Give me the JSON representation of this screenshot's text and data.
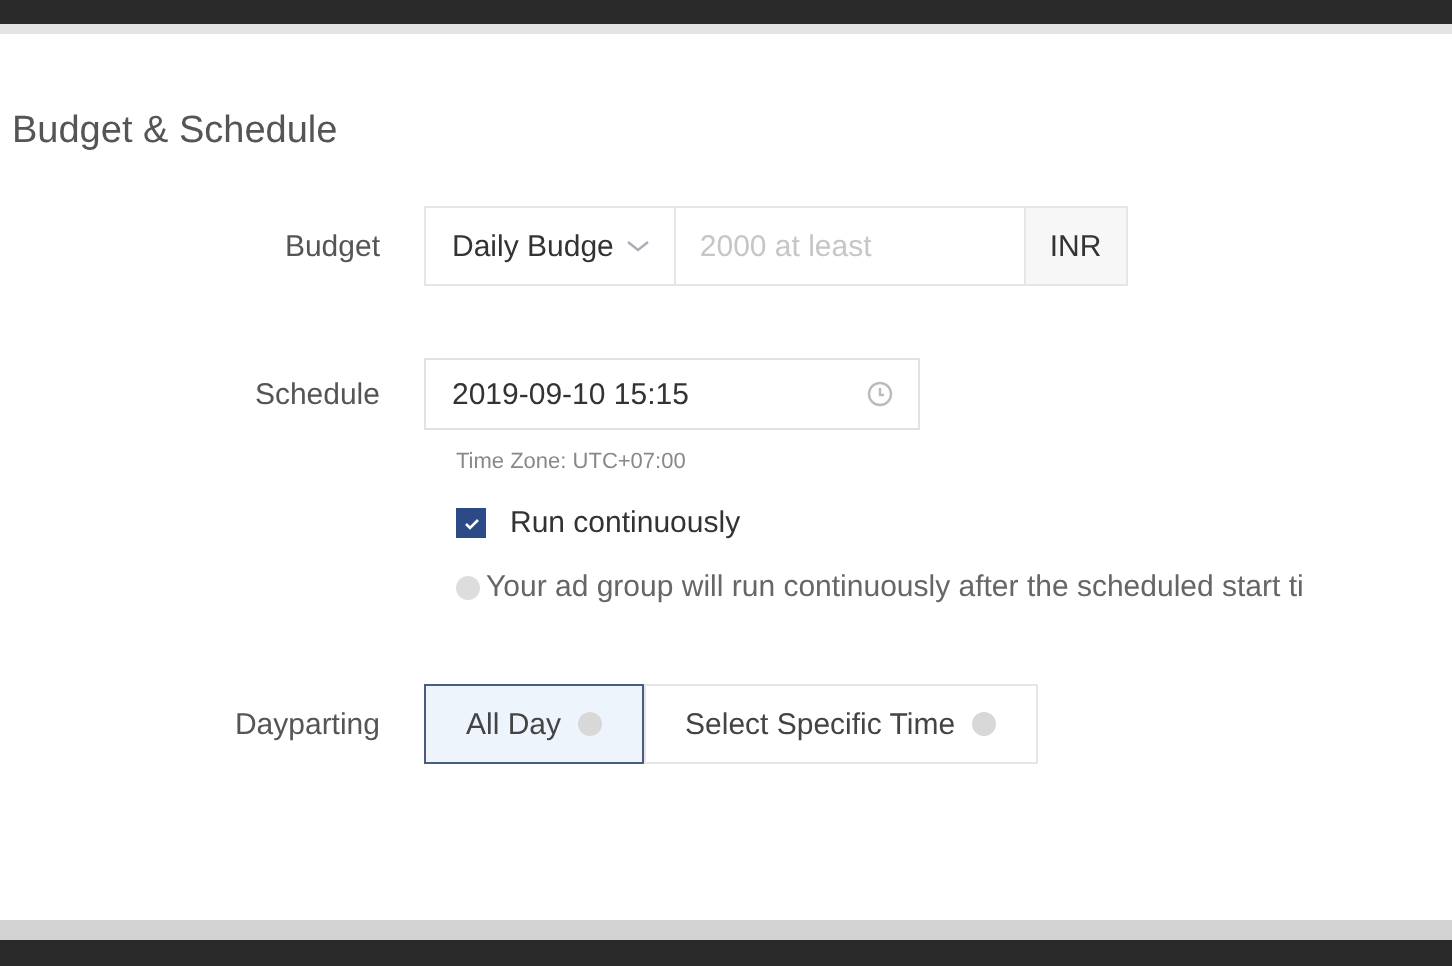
{
  "section": {
    "title": "Budget & Schedule"
  },
  "budget": {
    "label": "Budget",
    "type_select": {
      "value": "Daily Budge"
    },
    "amount": {
      "placeholder": "2000 at least"
    },
    "currency": "INR"
  },
  "schedule": {
    "label": "Schedule",
    "start": {
      "value": "2019-09-10 15:15"
    },
    "time_zone": "Time Zone: UTC+07:00",
    "run_continuously": {
      "label": "Run continuously",
      "checked": true
    },
    "hint": "Your ad group will run continuously after the scheduled start ti"
  },
  "dayparting": {
    "label": "Dayparting",
    "options": [
      {
        "label": "All Day",
        "selected": true
      },
      {
        "label": "Select Specific Time",
        "selected": false
      }
    ]
  }
}
